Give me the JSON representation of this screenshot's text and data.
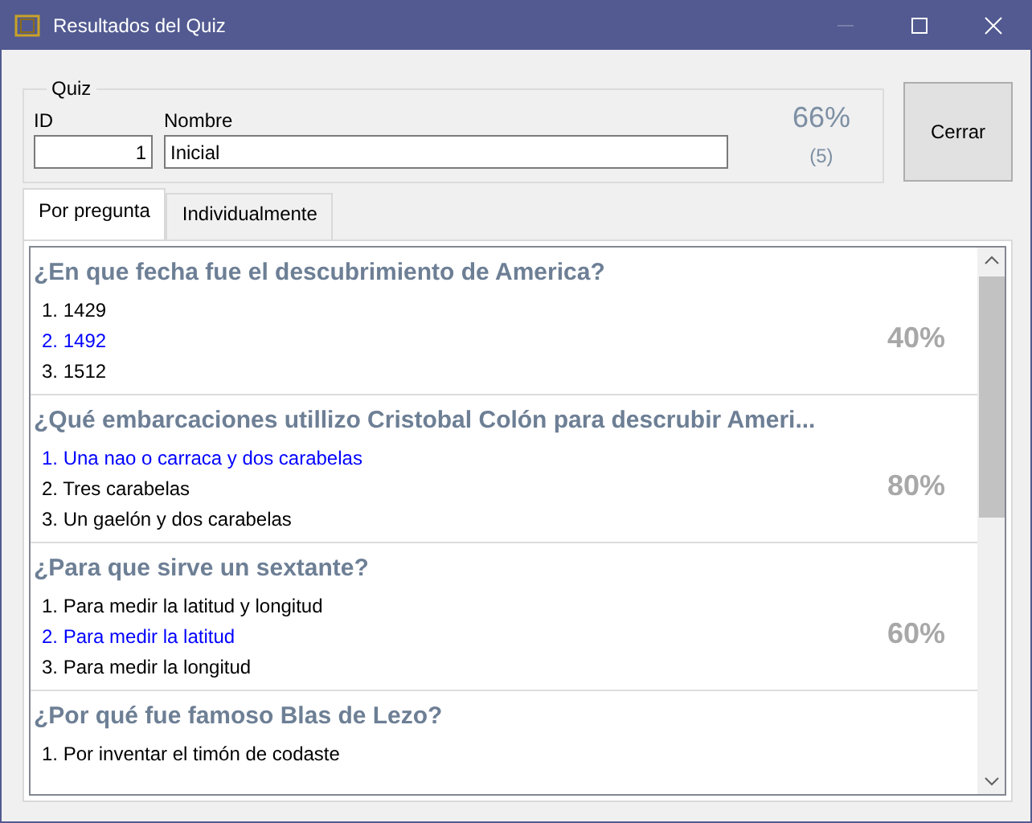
{
  "window": {
    "title": "Resultados del Quiz"
  },
  "quiz": {
    "legend": "Quiz",
    "id_label": "ID",
    "id_value": "1",
    "name_label": "Nombre",
    "name_value": "Inicial",
    "score": "66%",
    "count": "(5)"
  },
  "close_button": "Cerrar",
  "tabs": [
    {
      "label": "Por pregunta",
      "selected": true
    },
    {
      "label": "Individualmente",
      "selected": false
    }
  ],
  "questions": [
    {
      "title": "¿En que fecha fue el descubrimiento de America?",
      "percent": "40%",
      "answers": [
        {
          "text": "1. 1429",
          "correct": false
        },
        {
          "text": "2. 1492",
          "correct": true
        },
        {
          "text": "3. 1512",
          "correct": false
        }
      ]
    },
    {
      "title": "¿Qué embarcaciones utillizo Cristobal Colón para descrubir Ameri...",
      "percent": "80%",
      "answers": [
        {
          "text": "1. Una nao o carraca y dos carabelas",
          "correct": true
        },
        {
          "text": "2. Tres carabelas",
          "correct": false
        },
        {
          "text": "3. Un gaelón y dos carabelas",
          "correct": false
        }
      ]
    },
    {
      "title": "¿Para que sirve un sextante?",
      "percent": "60%",
      "answers": [
        {
          "text": "1. Para medir la latitud y longitud",
          "correct": false
        },
        {
          "text": "2. Para medir la latitud",
          "correct": true
        },
        {
          "text": "3. Para medir la longitud",
          "correct": false
        }
      ]
    },
    {
      "title": "¿Por qué fue famoso Blas de Lezo?",
      "answers": [
        {
          "text": "1. Por inventar el timón de codaste",
          "correct": false
        }
      ]
    }
  ]
}
